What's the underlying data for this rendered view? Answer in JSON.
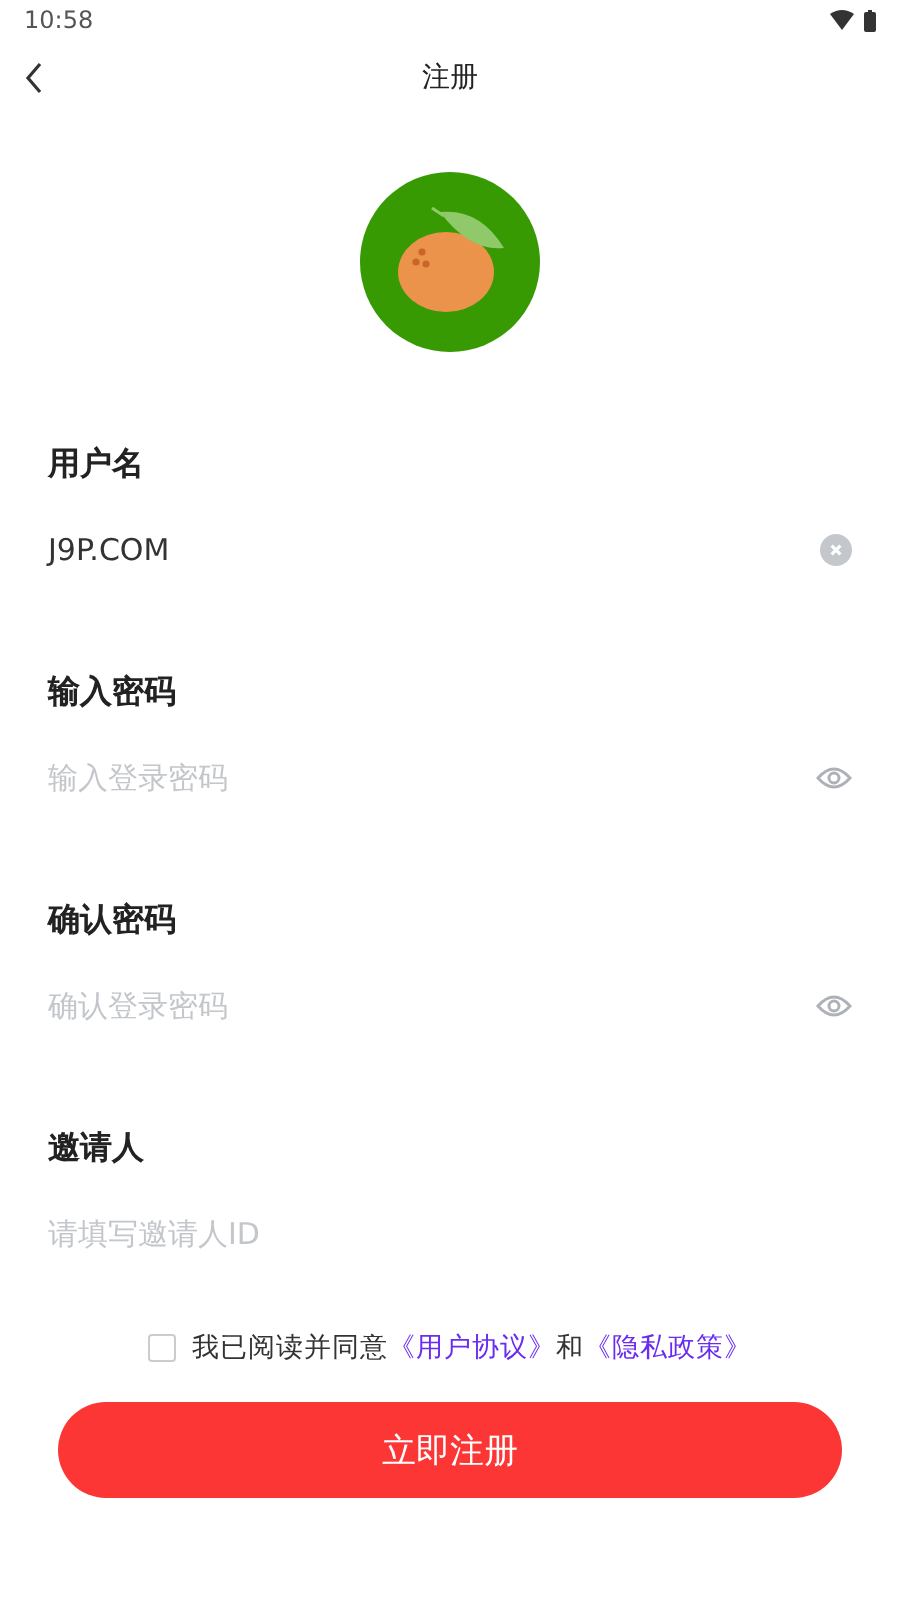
{
  "status_bar": {
    "time": "10:58"
  },
  "header": {
    "title": "注册"
  },
  "fields": [
    {
      "label": "用户名",
      "value": "J9P.COM",
      "kind": "clear"
    },
    {
      "label": "输入密码",
      "placeholder": "输入登录密码",
      "kind": "eye"
    },
    {
      "label": "确认密码",
      "placeholder": "确认登录密码",
      "kind": "eye"
    },
    {
      "label": "邀请人",
      "placeholder": "请填写邀请人ID",
      "kind": "plain"
    }
  ],
  "agreement": {
    "checked": false,
    "parts": [
      {
        "kind": "text",
        "text": "我已阅读并同意"
      },
      {
        "kind": "link",
        "text": "《用户协议》"
      },
      {
        "kind": "text",
        "text": "和"
      },
      {
        "kind": "link",
        "text": "《隐私政策》"
      }
    ]
  },
  "submit": {
    "label": "立即注册"
  }
}
